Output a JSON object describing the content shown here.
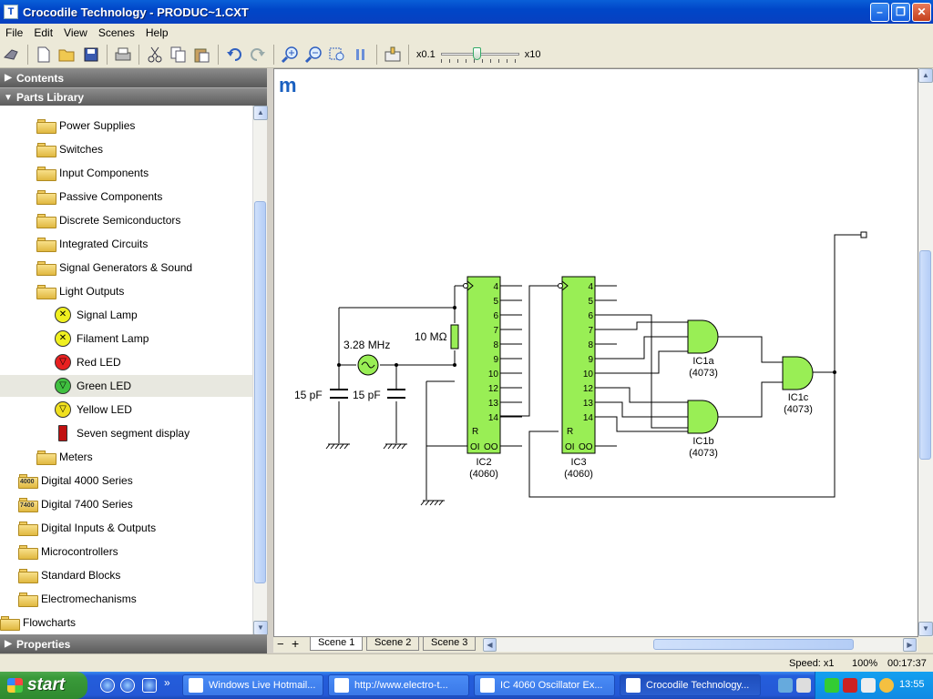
{
  "window": {
    "title": "Crocodile Technology - PRODUC~1.CXT",
    "app_icon": "T"
  },
  "menu": [
    "File",
    "Edit",
    "View",
    "Scenes",
    "Help"
  ],
  "toolbar": {
    "zoom_min": "x0.1",
    "zoom_max": "x10",
    "speed_slider_value": 0.45,
    "icons": [
      "tools-icon",
      "new-icon",
      "open-icon",
      "save-icon",
      "print-icon",
      "cut-icon",
      "copy-icon",
      "paste-icon",
      "undo-icon",
      "redo-icon",
      "zoom-in-icon",
      "zoom-out-icon",
      "zoom-fit-icon",
      "pause-icon",
      "pointer-icon"
    ]
  },
  "panels": {
    "contents": "Contents",
    "parts_library": "Parts Library",
    "properties": "Properties"
  },
  "tree": [
    {
      "label": "Power Supplies",
      "level": 1,
      "icon": "folder-power-icon"
    },
    {
      "label": "Switches",
      "level": 1,
      "icon": "folder-switch-icon"
    },
    {
      "label": "Input Components",
      "level": 1,
      "icon": "folder-input-icon"
    },
    {
      "label": "Passive Components",
      "level": 1,
      "icon": "folder-passive-icon"
    },
    {
      "label": "Discrete Semiconductors",
      "level": 1,
      "icon": "folder-semiconductor-icon"
    },
    {
      "label": "Integrated Circuits",
      "level": 1,
      "icon": "folder-ic-icon"
    },
    {
      "label": "Signal Generators & Sound",
      "level": 1,
      "icon": "folder-signal-icon"
    },
    {
      "label": "Light Outputs",
      "level": 1,
      "icon": "folder-light-icon",
      "open": true
    },
    {
      "label": "Signal Lamp",
      "level": 2,
      "icon": "signal-lamp-icon",
      "color": "#f0f020"
    },
    {
      "label": "Filament Lamp",
      "level": 2,
      "icon": "filament-lamp-icon",
      "color": "#f0f020"
    },
    {
      "label": "Red LED",
      "level": 2,
      "icon": "red-led-icon",
      "color": "#e82020"
    },
    {
      "label": "Green LED",
      "level": 2,
      "icon": "green-led-icon",
      "color": "#40c040",
      "selected": true
    },
    {
      "label": "Yellow LED",
      "level": 2,
      "icon": "yellow-led-icon",
      "color": "#f0e020"
    },
    {
      "label": "Seven segment display",
      "level": 2,
      "icon": "seven-segment-icon",
      "color": "#c01010"
    },
    {
      "label": "Meters",
      "level": 1,
      "icon": "folder-meters-icon"
    },
    {
      "label": "Digital 4000 Series",
      "level": 0,
      "icon": "digital-4000-icon",
      "badge": "4000"
    },
    {
      "label": "Digital 7400 Series",
      "level": 0,
      "icon": "digital-7400-icon",
      "badge": "7400"
    },
    {
      "label": "Digital Inputs & Outputs",
      "level": 0,
      "icon": "digital-io-icon"
    },
    {
      "label": "Microcontrollers",
      "level": 0,
      "icon": "microcontroller-icon"
    },
    {
      "label": "Standard Blocks",
      "level": 0,
      "icon": "standard-blocks-icon"
    },
    {
      "label": "Electromechanisms",
      "level": 0,
      "icon": "electromechanisms-icon"
    },
    {
      "label": "Flowcharts",
      "level": -1,
      "icon": "flowcharts-icon"
    }
  ],
  "circuit": {
    "logo": "m",
    "osc_freq": "3.28 MHz",
    "resistor": "10 MΩ",
    "cap1": "15 pF",
    "cap2": "15 pF",
    "ic2_name": "IC2",
    "ic2_type": "(4060)",
    "ic3_name": "IC3",
    "ic3_type": "(4060)",
    "pins": [
      "4",
      "5",
      "6",
      "7",
      "8",
      "9",
      "10",
      "12",
      "13",
      "14"
    ],
    "pin_r": "R",
    "pin_oi": "OI",
    "pin_oo": "OO",
    "gate1_name": "IC1a",
    "gate1_type": "(4073)",
    "gate2_name": "IC1b",
    "gate2_type": "(4073)",
    "gate3_name": "IC1c",
    "gate3_type": "(4073)"
  },
  "scenes": [
    "Scene 1",
    "Scene 2",
    "Scene 3"
  ],
  "scene_controls": {
    "minus": "−",
    "plus": "+"
  },
  "status": {
    "speed": "Speed: x1",
    "zoom": "100%",
    "time": "00:17:37"
  },
  "taskbar": {
    "start": "start",
    "tasks": [
      {
        "label": "Windows Live Hotmail..."
      },
      {
        "label": "http://www.electro-t..."
      },
      {
        "label": "IC 4060 Oscillator Ex..."
      },
      {
        "label": "Crocodile Technology...",
        "active": true
      }
    ],
    "clock": "13:55"
  },
  "colors": {
    "titlebar": "#0046c8",
    "chip": "#99ee55",
    "panel_header": "#6e6e6e",
    "taskbar": "#245edb",
    "start": "#3a9a3a"
  }
}
